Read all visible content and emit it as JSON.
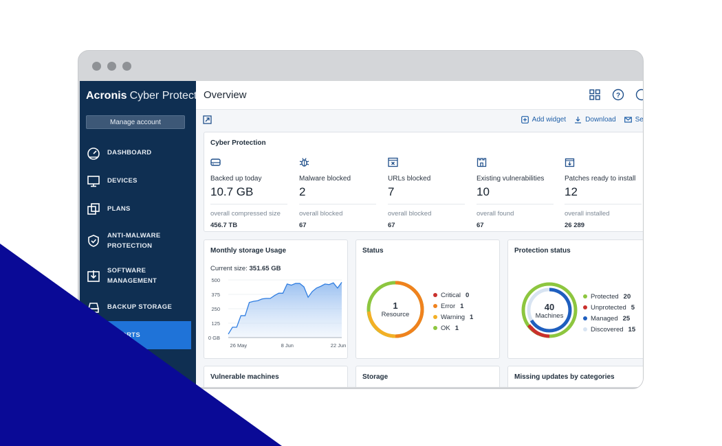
{
  "app": {
    "brand_bold": "Acronis",
    "brand_rest": "Cyber Protect",
    "manage_account": "Manage account"
  },
  "sidebar": {
    "items": [
      {
        "label": "DASHBOARD",
        "icon": "gauge-icon"
      },
      {
        "label": "DEVICES",
        "icon": "monitor-icon"
      },
      {
        "label": "PLANS",
        "icon": "plans-icon"
      },
      {
        "label": "ANTI-MALWARE PROTECTION",
        "icon": "shield-icon"
      },
      {
        "label": "SOFTWARE MANAGEMENT",
        "icon": "software-icon"
      },
      {
        "label": "BACKUP STORAGE",
        "icon": "database-icon"
      },
      {
        "label": "REPORTS",
        "icon": "reports-icon",
        "active": true
      }
    ]
  },
  "header": {
    "title": "Overview"
  },
  "toolbar": {
    "add_widget": "Add widget",
    "download": "Download",
    "send": "Send"
  },
  "cyber_protection": {
    "title": "Cyber Protection",
    "metrics": [
      {
        "label": "Backed up today",
        "value": "10.7 GB",
        "sub": "overall compressed size",
        "subval": "456.7 TB",
        "icon": "drive-icon"
      },
      {
        "label": "Malware blocked",
        "value": "2",
        "sub": "overall blocked",
        "subval": "67",
        "icon": "bug-icon"
      },
      {
        "label": "URLs blocked",
        "value": "7",
        "sub": "overall blocked",
        "subval": "67",
        "icon": "url-block-icon"
      },
      {
        "label": "Existing vulnerabilities",
        "value": "10",
        "sub": "overall found",
        "subval": "67",
        "icon": "castle-icon"
      },
      {
        "label": "Patches ready to install",
        "value": "12",
        "sub": "overall installed",
        "subval": "26 289",
        "icon": "patch-icon"
      }
    ]
  },
  "storage_widget": {
    "title": "Monthly storage Usage",
    "current_label": "Current size:",
    "current_value": "351.65 GB"
  },
  "chart_data": {
    "type": "area",
    "title": "Monthly storage Usage",
    "xlabel": "",
    "ylabel": "",
    "ylim": [
      0,
      500
    ],
    "yticks": [
      "0 GB",
      "125",
      "250",
      "375",
      "500"
    ],
    "xticks": [
      "26 May",
      "8 Jun",
      "22 Jun"
    ],
    "x": [
      0,
      1,
      2,
      3,
      4,
      5,
      6,
      7,
      8,
      9,
      10,
      11,
      12,
      13,
      14,
      15,
      16,
      17,
      18,
      19,
      20,
      21,
      22,
      23,
      24,
      25,
      26,
      27
    ],
    "values": [
      30,
      90,
      90,
      190,
      190,
      305,
      315,
      320,
      335,
      340,
      340,
      365,
      385,
      385,
      465,
      455,
      470,
      470,
      440,
      350,
      400,
      430,
      445,
      465,
      460,
      475,
      430,
      480
    ]
  },
  "status_widget": {
    "title": "Status",
    "center_value": "1",
    "center_label": "Resource",
    "legend": [
      {
        "label": "Critical",
        "value": "0",
        "color": "#c9302c"
      },
      {
        "label": "Error",
        "value": "1",
        "color": "#f0821e"
      },
      {
        "label": "Warning",
        "value": "1",
        "color": "#f3b026"
      },
      {
        "label": "OK",
        "value": "1",
        "color": "#8dc63f"
      }
    ]
  },
  "protection_widget": {
    "title": "Protection status",
    "center_value": "40",
    "center_label": "Machines",
    "legend": [
      {
        "label": "Protected",
        "value": "20",
        "color": "#8dc63f"
      },
      {
        "label": "Unprotected",
        "value": "5",
        "color": "#c9302c"
      },
      {
        "label": "Managed",
        "value": "25",
        "color": "#1f5fbf"
      },
      {
        "label": "Discovered",
        "value": "15",
        "color": "#d8e4f2"
      }
    ]
  },
  "bottom_widgets": {
    "vulnerable": "Vulnerable machines",
    "storage": "Storage",
    "missing": "Missing updates by categories"
  }
}
